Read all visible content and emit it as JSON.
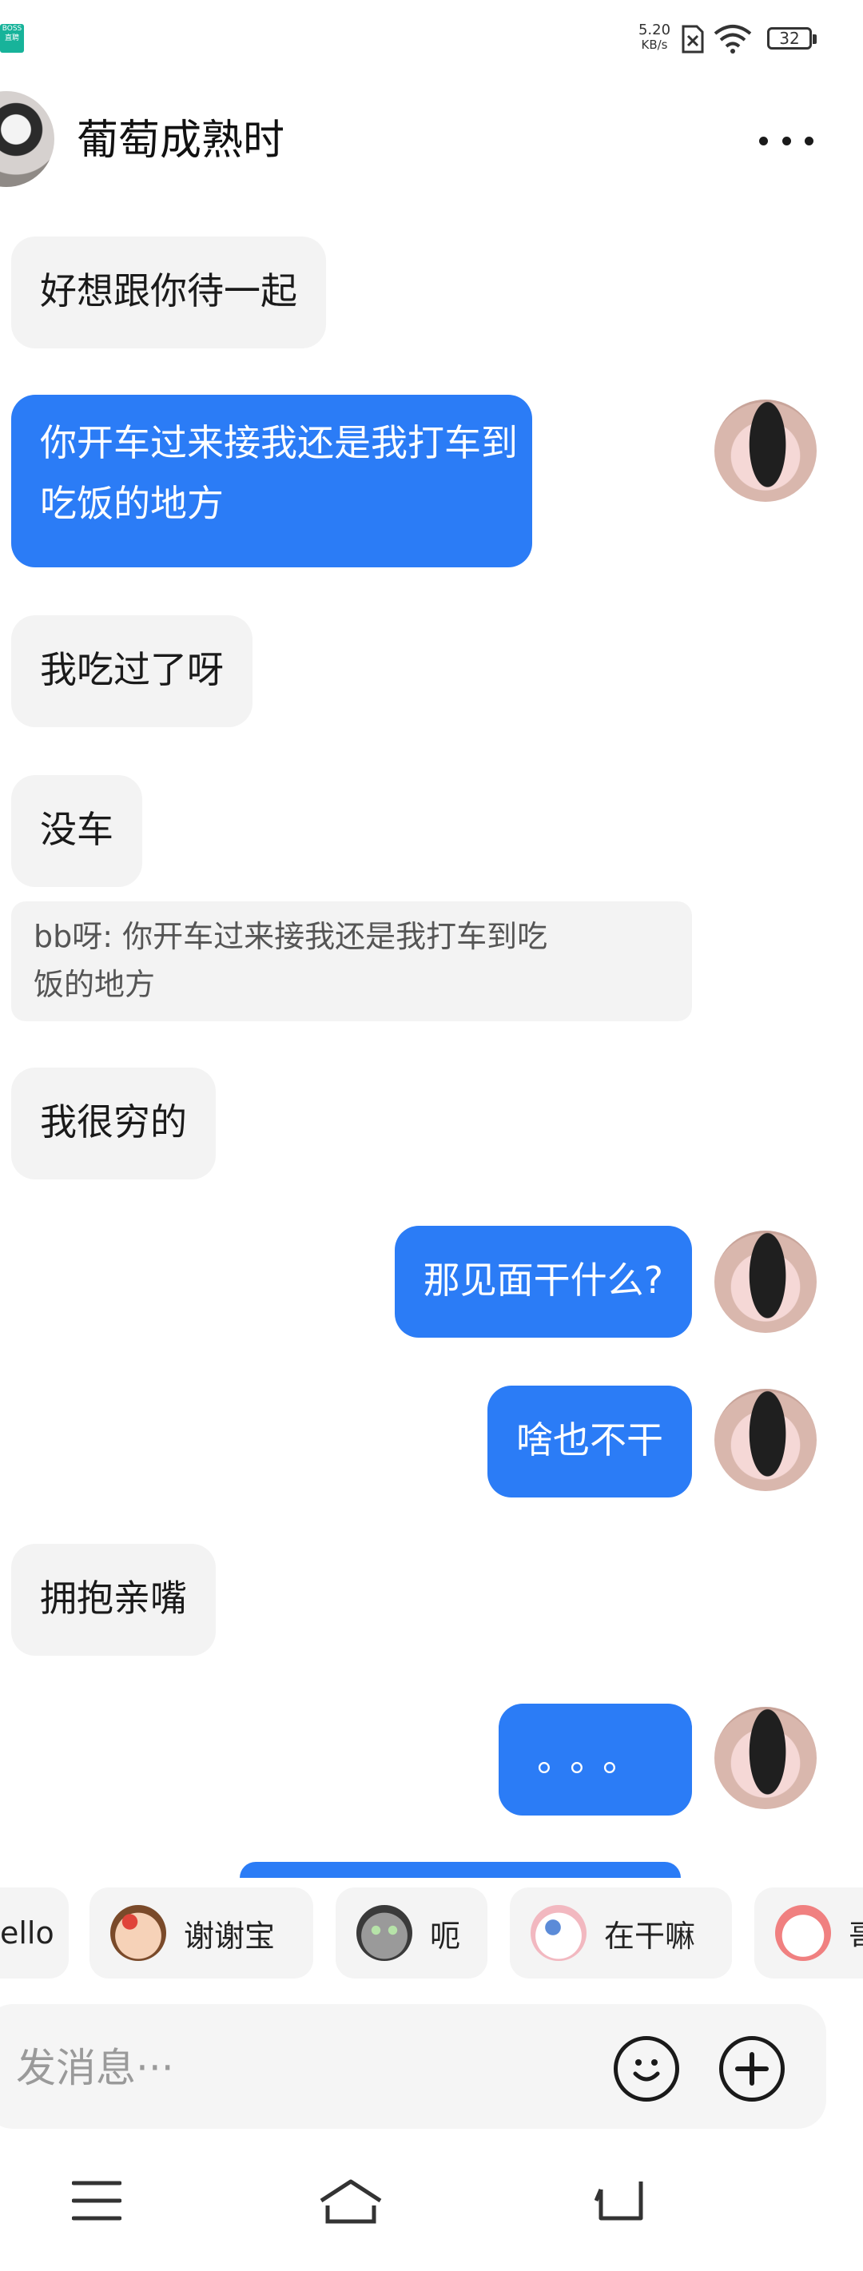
{
  "status_bar": {
    "app_badge": [
      "BOSS",
      "直聘"
    ],
    "net_speed": "5.20",
    "net_unit": "KB/s",
    "battery": "32"
  },
  "header": {
    "title": "葡萄成熟时"
  },
  "messages": [
    {
      "side": "in",
      "text": "好想跟你待一起"
    },
    {
      "side": "out",
      "lines": [
        "你开车过来接我还是我打车到",
        "吃饭的地方"
      ]
    },
    {
      "side": "in",
      "text": "我吃过了呀"
    },
    {
      "side": "in",
      "text": "没车"
    },
    {
      "side": "quote",
      "lines": [
        "bb呀: 你开车过来接我还是我打车到吃",
        "饭的地方"
      ]
    },
    {
      "side": "in",
      "text": "我很穷的"
    },
    {
      "side": "out",
      "text": "那见面干什么?"
    },
    {
      "side": "out",
      "text": "啥也不干"
    },
    {
      "side": "in",
      "text": "拥抱亲嘴"
    },
    {
      "side": "out",
      "text": "。。。"
    }
  ],
  "quick_replies": [
    "ello",
    "谢谢宝",
    "呃",
    "在干嘛",
    "哥"
  ],
  "input": {
    "placeholder": "发消息···"
  },
  "colors": {
    "outgoing_bubble": "#2b7cf6",
    "incoming_bubble": "#f3f3f3",
    "quote_text": "#555555"
  }
}
